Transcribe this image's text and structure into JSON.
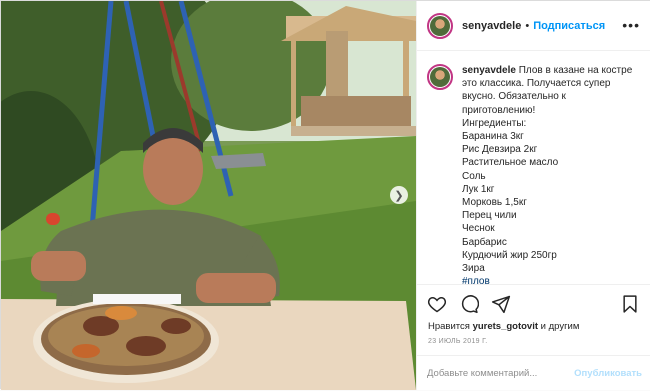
{
  "header": {
    "username": "senyavdele",
    "separator": "•",
    "follow_label": "Подписаться",
    "more_label": "•••"
  },
  "caption": {
    "username": "senyavdele",
    "lines": [
      "Плов в казане на костре",
      "это классика. Получается супер",
      "вкусно. Обязательно к",
      "приготовлению!",
      "Ингредиенты:",
      "Баранина 3кг",
      "Рис Девзира 2кг",
      "Растительное масло",
      "Соль",
      "Лук 1кг",
      "Морковь 1,5кг",
      "Перец чили",
      "Чеснок",
      "Барбарис",
      "Курдючий жир 250гр",
      "Зира"
    ],
    "hashtag": "#плов"
  },
  "actions": {
    "like_icon": "heart-icon",
    "comment_icon": "comment-icon",
    "share_icon": "share-icon",
    "save_icon": "bookmark-icon"
  },
  "likes": {
    "prefix": "Нравится",
    "user": "yurets_gotovit",
    "suffix": "и другим"
  },
  "date": "23 ИЮЛЬ 2019 Г.",
  "comment": {
    "placeholder": "Добавьте комментарий...",
    "publish_label": "Опубликовать"
  },
  "photo": {
    "next_icon": "chevron-right-icon",
    "description_hidden": true
  },
  "colors": {
    "accent": "#0095f6",
    "publish_disabled": "#b2dffc",
    "hashtag": "#00376b",
    "muted": "#8e8e8e"
  }
}
